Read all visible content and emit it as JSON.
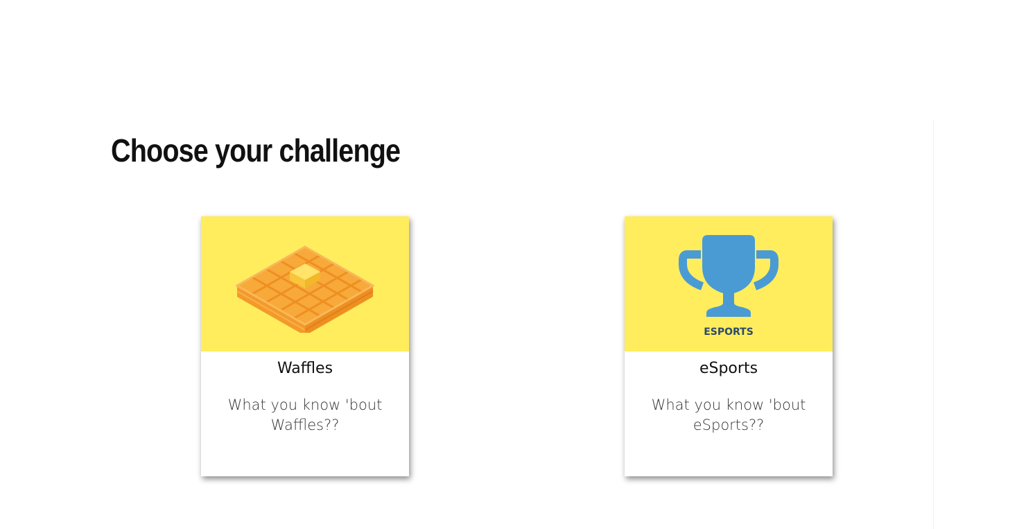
{
  "page": {
    "heading": "Choose your challenge"
  },
  "challenges": [
    {
      "title": "Waffles",
      "description": "What you know 'bout Waffles??",
      "image_icon": "waffle-icon",
      "image_bg": "#ffed5e"
    },
    {
      "title": "eSports",
      "description": "What you know 'bout eSports??",
      "image_icon": "trophy-icon",
      "image_caption": "ESPORTS",
      "image_bg": "#ffed5e"
    }
  ],
  "colors": {
    "card_image_bg": "#ffed5e",
    "waffle_orange": "#f7a93a",
    "waffle_dark": "#ee8f21",
    "butter": "#ffd84a",
    "trophy_blue": "#4a9bd4",
    "esports_text": "#2d4a6b"
  }
}
